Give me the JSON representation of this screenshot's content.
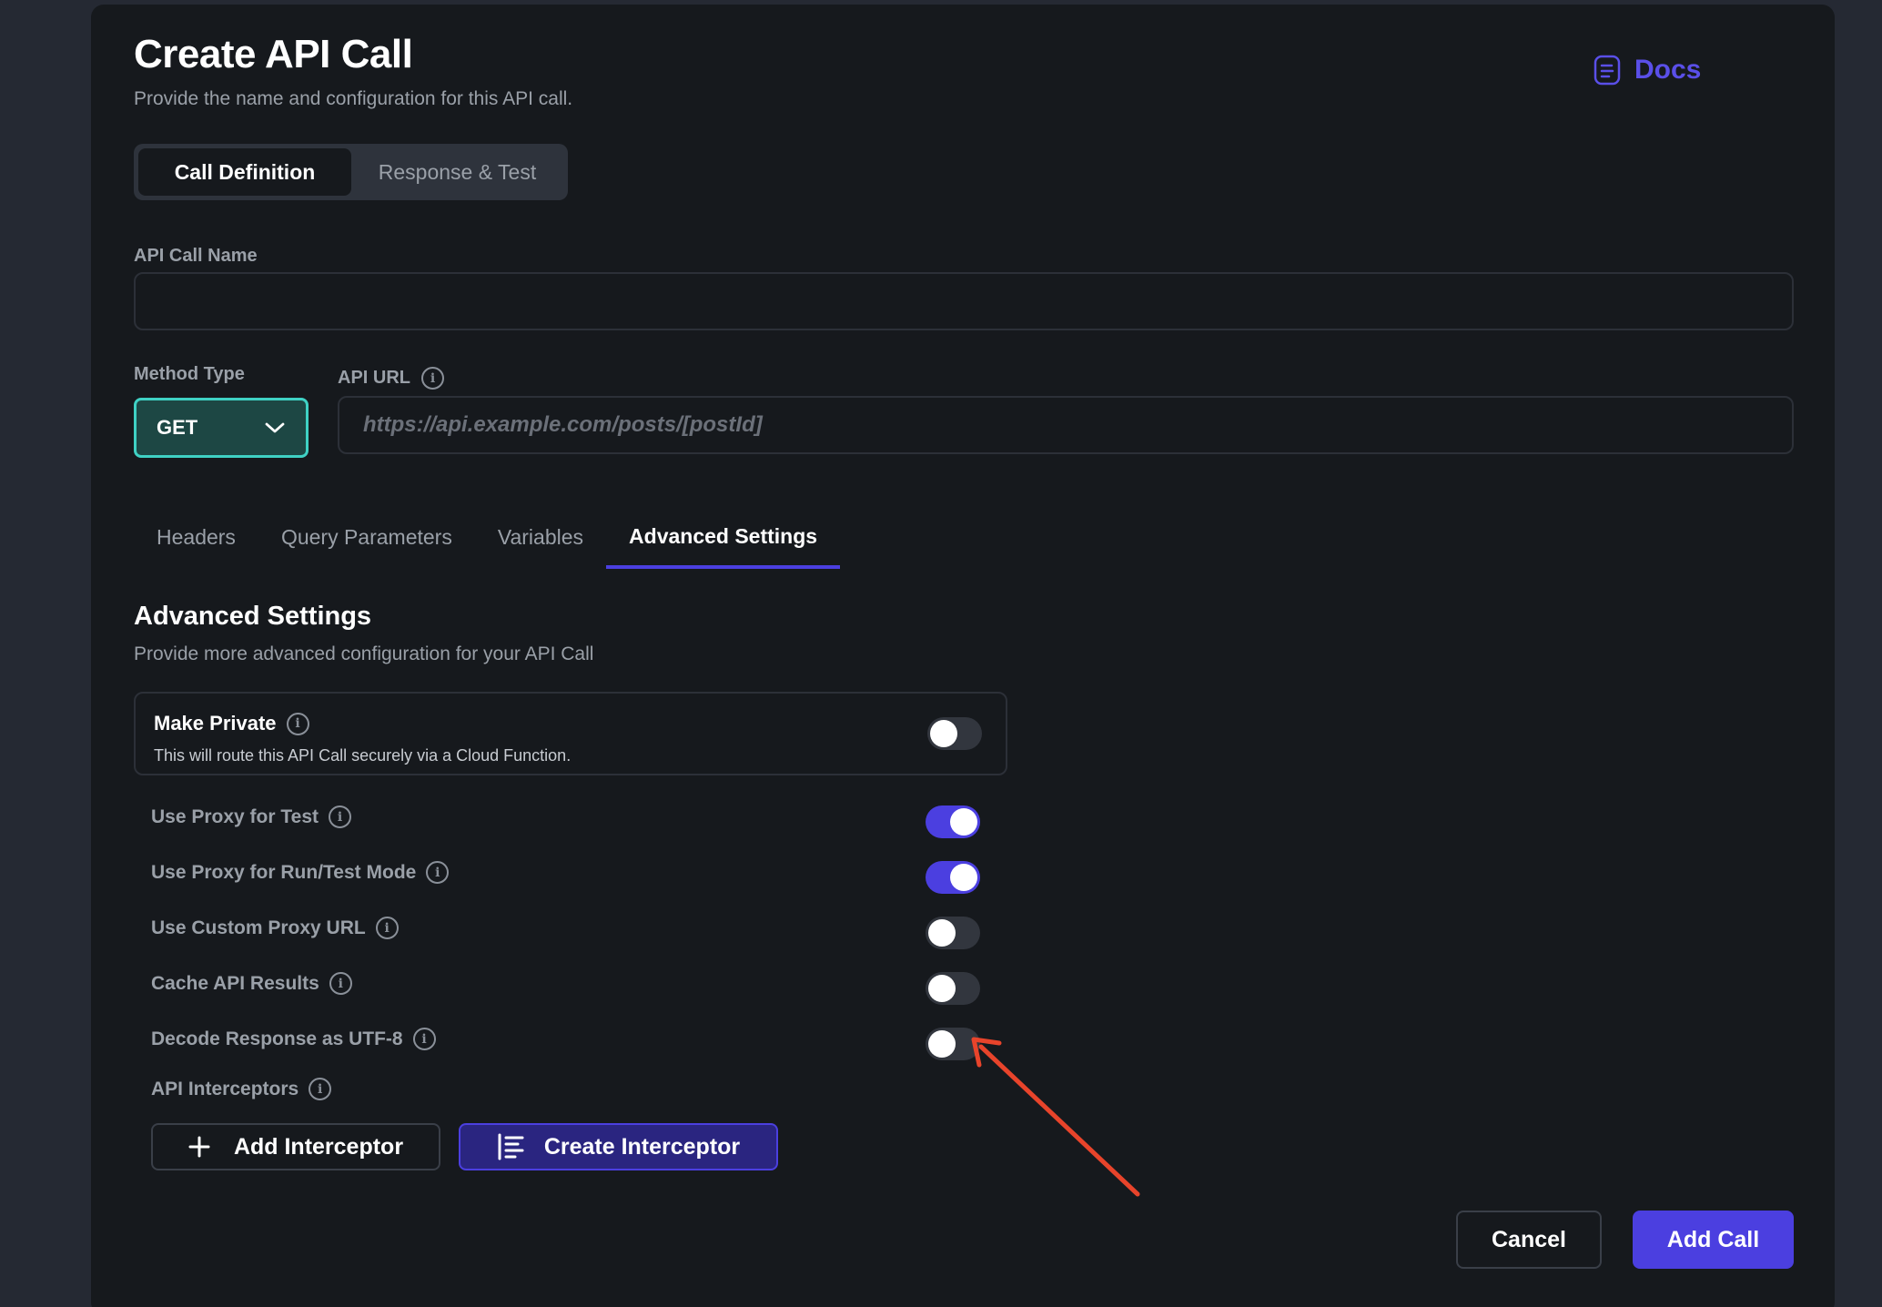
{
  "header": {
    "title": "Create API Call",
    "subtitle": "Provide the name and configuration for this API call.",
    "docs_label": "Docs"
  },
  "mode_tabs": [
    {
      "label": "Call Definition",
      "active": true
    },
    {
      "label": "Response & Test",
      "active": false
    }
  ],
  "form": {
    "name_label": "API Call Name",
    "name_value": "",
    "method_label": "Method Type",
    "method_value": "GET",
    "url_label": "API URL",
    "url_placeholder": "https://api.example.com/posts/[postId]"
  },
  "tabs": [
    {
      "label": "Headers",
      "active": false
    },
    {
      "label": "Query Parameters",
      "active": false
    },
    {
      "label": "Variables",
      "active": false
    },
    {
      "label": "Advanced Settings",
      "active": true
    }
  ],
  "advanced": {
    "title": "Advanced Settings",
    "subtitle": "Provide more advanced configuration for your API Call",
    "make_private": {
      "title": "Make Private",
      "description": "This will route this API Call securely via a Cloud Function.",
      "enabled": false
    },
    "settings": [
      {
        "label": "Use Proxy for Test",
        "enabled": true
      },
      {
        "label": "Use Proxy for Run/Test Mode",
        "enabled": true
      },
      {
        "label": "Use Custom Proxy URL",
        "enabled": false
      },
      {
        "label": "Cache API Results",
        "enabled": false
      },
      {
        "label": "Decode Response as UTF-8",
        "enabled": false
      }
    ],
    "interceptors_label": "API Interceptors",
    "add_interceptor": "Add Interceptor",
    "create_interceptor": "Create Interceptor"
  },
  "footer": {
    "cancel": "Cancel",
    "add_call": "Add Call"
  },
  "colors": {
    "accent": "#4b3fe0",
    "teal_focus": "#3fd1c4",
    "annotation_arrow": "#e8442b"
  }
}
